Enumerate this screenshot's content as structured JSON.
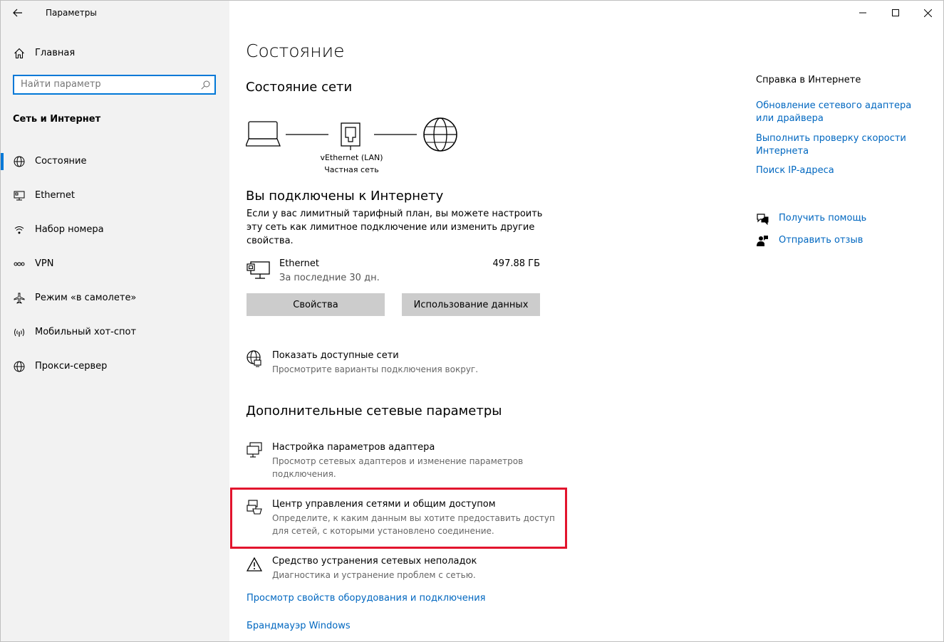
{
  "window": {
    "app_title": "Параметры"
  },
  "sidebar": {
    "home_label": "Главная",
    "search_placeholder": "Найти параметр",
    "section_title": "Сеть и Интернет",
    "items": [
      {
        "label": "Состояние",
        "icon": "globe-icon",
        "active": true
      },
      {
        "label": "Ethernet",
        "icon": "ethernet-icon",
        "active": false
      },
      {
        "label": "Набор номера",
        "icon": "dialup-icon",
        "active": false
      },
      {
        "label": "VPN",
        "icon": "vpn-icon",
        "active": false
      },
      {
        "label": "Режим «в самолете»",
        "icon": "airplane-icon",
        "active": false
      },
      {
        "label": "Мобильный хот-спот",
        "icon": "hotspot-icon",
        "active": false
      },
      {
        "label": "Прокси-сервер",
        "icon": "proxy-globe-icon",
        "active": false
      }
    ]
  },
  "main": {
    "page_title": "Состояние",
    "network_status_title": "Состояние сети",
    "diagram": {
      "adapter_name": "vEthernet (LAN)",
      "network_type": "Частная сеть"
    },
    "connected_title": "Вы подключены к Интернету",
    "connected_desc": "Если у вас лимитный тарифный план, вы можете настроить эту сеть как лимитное подключение или изменить другие свойства.",
    "connection": {
      "name": "Ethernet",
      "period": "За последние 30 дн.",
      "usage": "497.88 ГБ"
    },
    "buttons": {
      "properties": "Свойства",
      "data_usage": "Использование данных"
    },
    "show_networks": {
      "title": "Показать доступные сети",
      "desc": "Просмотрите варианты подключения вокруг."
    },
    "advanced_title": "Дополнительные сетевые параметры",
    "adapter_options": {
      "title": "Настройка параметров адаптера",
      "desc": "Просмотр сетевых адаптеров и изменение параметров подключения."
    },
    "sharing_center": {
      "title": "Центр управления сетями и общим доступом",
      "desc": "Определите, к каким данным вы хотите предоставить доступ для сетей, с которыми установлено соединение."
    },
    "troubleshooter": {
      "title": "Средство устранения сетевых неполадок",
      "desc": "Диагностика и устранение проблем с сетью."
    },
    "links": {
      "hardware_props": "Просмотр свойств оборудования и подключения",
      "firewall": "Брандмауэр Windows"
    }
  },
  "right": {
    "help_title": "Справка в Интернете",
    "links": [
      "Обновление сетевого адаптера или драйвера",
      "Выполнить проверку скорости Интернета",
      "Поиск IP-адреса"
    ],
    "get_help": "Получить помощь",
    "feedback": "Отправить отзыв"
  },
  "colors": {
    "accent": "#0078d7",
    "link": "#0067c0",
    "highlight": "#e2142d"
  }
}
